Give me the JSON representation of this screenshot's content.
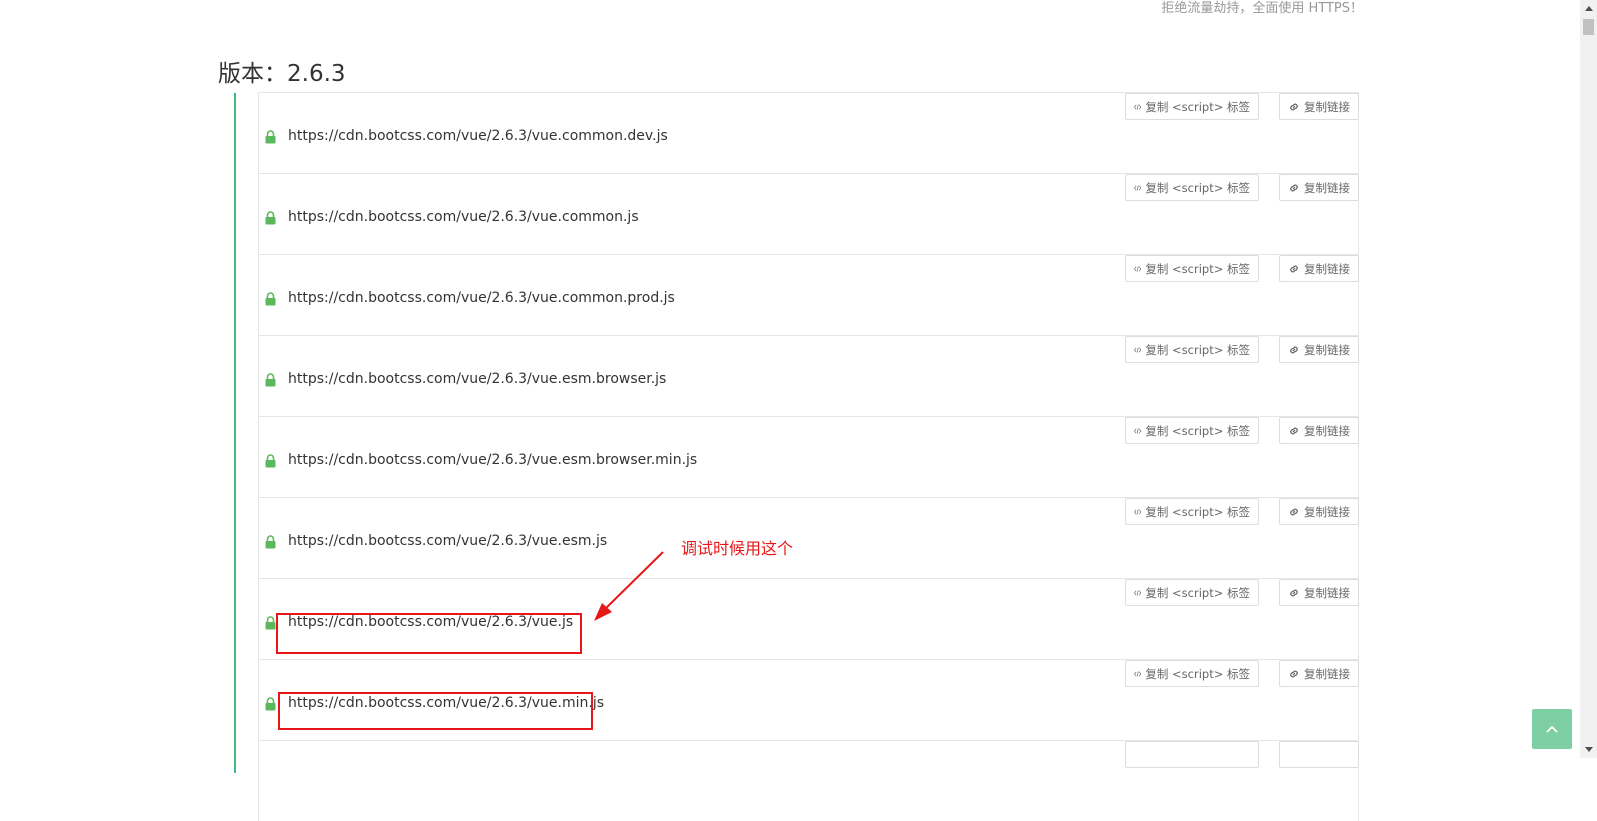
{
  "header": {
    "https_note": "拒绝流量劫持，全面使用 HTTPS！"
  },
  "version": {
    "title": "版本：2.6.3"
  },
  "buttons": {
    "script_label": "复制 <script> 标签",
    "link_label": "复制链接"
  },
  "files": [
    {
      "url": "https://cdn.bootcss.com/vue/2.6.3/vue.common.dev.js"
    },
    {
      "url": "https://cdn.bootcss.com/vue/2.6.3/vue.common.js"
    },
    {
      "url": "https://cdn.bootcss.com/vue/2.6.3/vue.common.prod.js"
    },
    {
      "url": "https://cdn.bootcss.com/vue/2.6.3/vue.esm.browser.js"
    },
    {
      "url": "https://cdn.bootcss.com/vue/2.6.3/vue.esm.browser.min.js"
    },
    {
      "url": "https://cdn.bootcss.com/vue/2.6.3/vue.esm.js"
    },
    {
      "url": "https://cdn.bootcss.com/vue/2.6.3/vue.js"
    },
    {
      "url": "https://cdn.bootcss.com/vue/2.6.3/vue.min.js"
    },
    {
      "url": ""
    }
  ],
  "annotation": {
    "text": "调试时候用这个"
  },
  "icons": {
    "lock": "lock-icon",
    "code": "code-icon",
    "link": "link-icon",
    "back_to_top": "chevron-up-icon"
  },
  "colors": {
    "accent_green": "#42b983",
    "lock_green": "#5cb85c",
    "annotation_red": "#e81717",
    "back_top_green": "#7fcfa4"
  }
}
